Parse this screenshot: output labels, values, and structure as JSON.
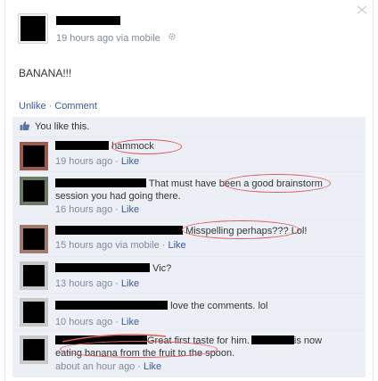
{
  "post": {
    "timestamp": "19 hours ago via mobile",
    "text": "BANANA!!!",
    "unlike": "Unlike",
    "comment": "Comment",
    "separator": "·",
    "likes": "You like this."
  },
  "comments": [
    {
      "text": "hammock",
      "meta": "19 hours ago",
      "like": "Like"
    },
    {
      "text": "That must have been a good brainstorm",
      "text2": "session you had going there.",
      "meta": "16 hours ago",
      "like": "Like"
    },
    {
      "text": "Misspelling perhaps??? Lol!",
      "meta": "15 hours ago via mobile",
      "like": "Like"
    },
    {
      "text": "Vic?",
      "meta": "13 hours ago",
      "like": "Like"
    },
    {
      "text": "love the comments. lol",
      "meta": "10 hours ago",
      "like": "Like"
    },
    {
      "text": "Great first taste for him.",
      "text_b": "is now",
      "text2": "eating banana from the fruit to the spoon.",
      "meta": "about an hour ago",
      "like": "Like"
    }
  ],
  "colors": {
    "link": "#3b5998",
    "meta": "#808b9c",
    "panel": "#eceff5",
    "annotation": "#e05a5a"
  },
  "icons": {
    "corner": "chevron-icon",
    "gear": "gear-icon",
    "thumb": "thumbs-up-icon"
  }
}
